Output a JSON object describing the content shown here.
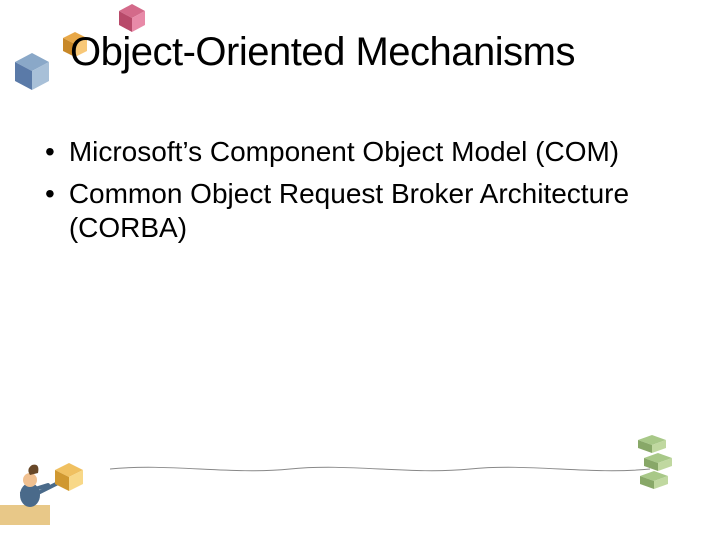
{
  "slide": {
    "title": "Object-Oriented Mechanisms",
    "bullets": [
      "Microsoft’s Component Object Model (COM)",
      "Common Object Request Broker Architecture (CORBA)"
    ]
  }
}
